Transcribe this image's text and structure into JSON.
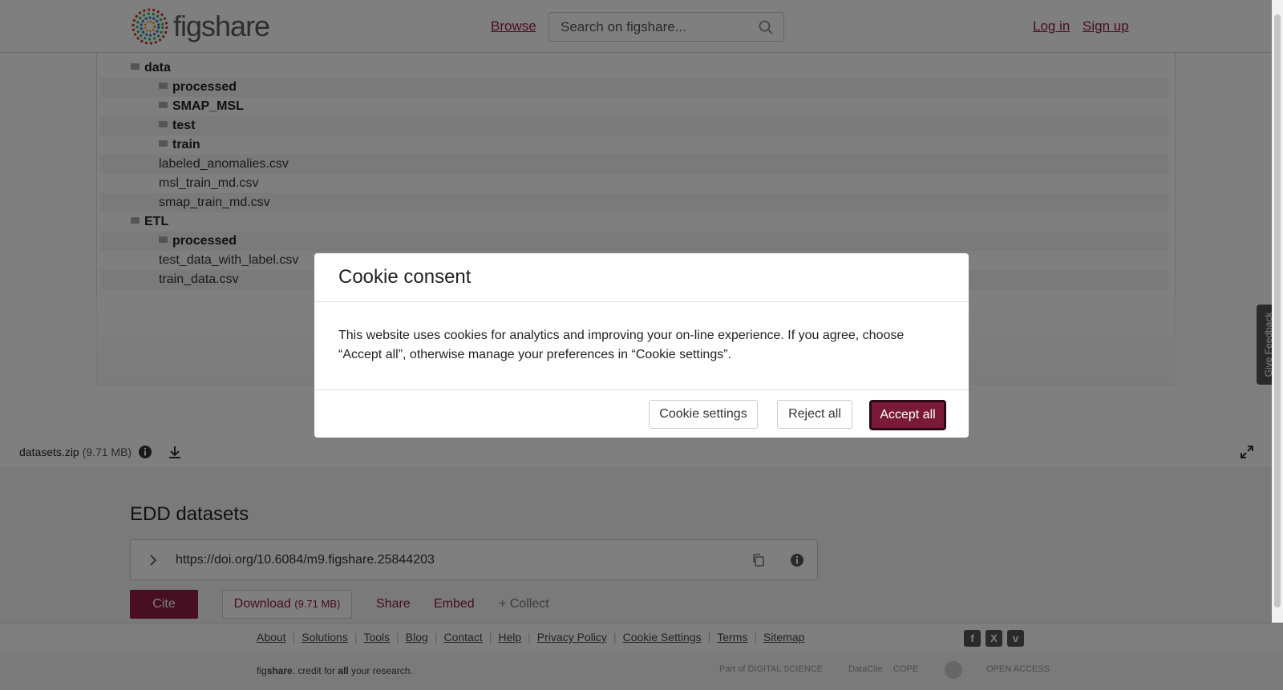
{
  "header": {
    "logo_text": "figshare",
    "browse_label": "Browse",
    "search_placeholder": "Search on figshare...",
    "login_label": "Log in",
    "signup_label": "Sign up"
  },
  "file_tree": [
    {
      "label": "data",
      "type": "folder"
    },
    {
      "label": "processed",
      "type": "folder"
    },
    {
      "label": "SMAP_MSL",
      "type": "folder"
    },
    {
      "label": "test",
      "type": "folder"
    },
    {
      "label": "train",
      "type": "folder"
    },
    {
      "label": "labeled_anomalies.csv",
      "type": "file"
    },
    {
      "label": "msl_train_md.csv",
      "type": "file"
    },
    {
      "label": "smap_train_md.csv",
      "type": "file"
    },
    {
      "label": "ETL",
      "type": "folder"
    },
    {
      "label": "processed",
      "type": "folder"
    },
    {
      "label": "test_data_with_label.csv",
      "type": "file"
    },
    {
      "label": "train_data.csv",
      "type": "file"
    }
  ],
  "file_info": {
    "name": "datasets.zip",
    "size": "(9.71 MB)"
  },
  "dataset": {
    "title": "EDD datasets",
    "doi": "https://doi.org/10.6084/m9.figshare.25844203",
    "cite_label": "Cite",
    "download_label": "Download",
    "download_size": "(9.71 MB)",
    "share_label": "Share",
    "embed_label": "Embed",
    "collect_label": "+ Collect"
  },
  "footer": {
    "links": [
      "About",
      "Solutions",
      "Tools",
      "Blog",
      "Contact",
      "Help",
      "Privacy Policy",
      "Cookie Settings",
      "Terms",
      "Sitemap"
    ],
    "social": [
      "f",
      "X",
      "v"
    ],
    "tagline_pre": "fig",
    "tagline_bold": "share",
    "tagline_mid": ". credit for ",
    "tagline_all": "all",
    "tagline_end": " your research.",
    "partner_digital_science": "Part of DIGITAL SCIENCE",
    "partner_datacite": "DataCite",
    "partner_cope": "COPE",
    "partner_open_access": "OPEN ACCESS"
  },
  "feedback_label": "Give Feedback",
  "cookie_modal": {
    "title": "Cookie consent",
    "body": "This website uses cookies for analytics and improving your on-line experience. If you agree, choose “Accept all”, otherwise manage your preferences in “Cookie settings”.",
    "settings_label": "Cookie settings",
    "reject_label": "Reject all",
    "accept_label": "Accept all"
  },
  "colors": {
    "brand": "#8c1d40",
    "accept": "#7a1a38"
  }
}
